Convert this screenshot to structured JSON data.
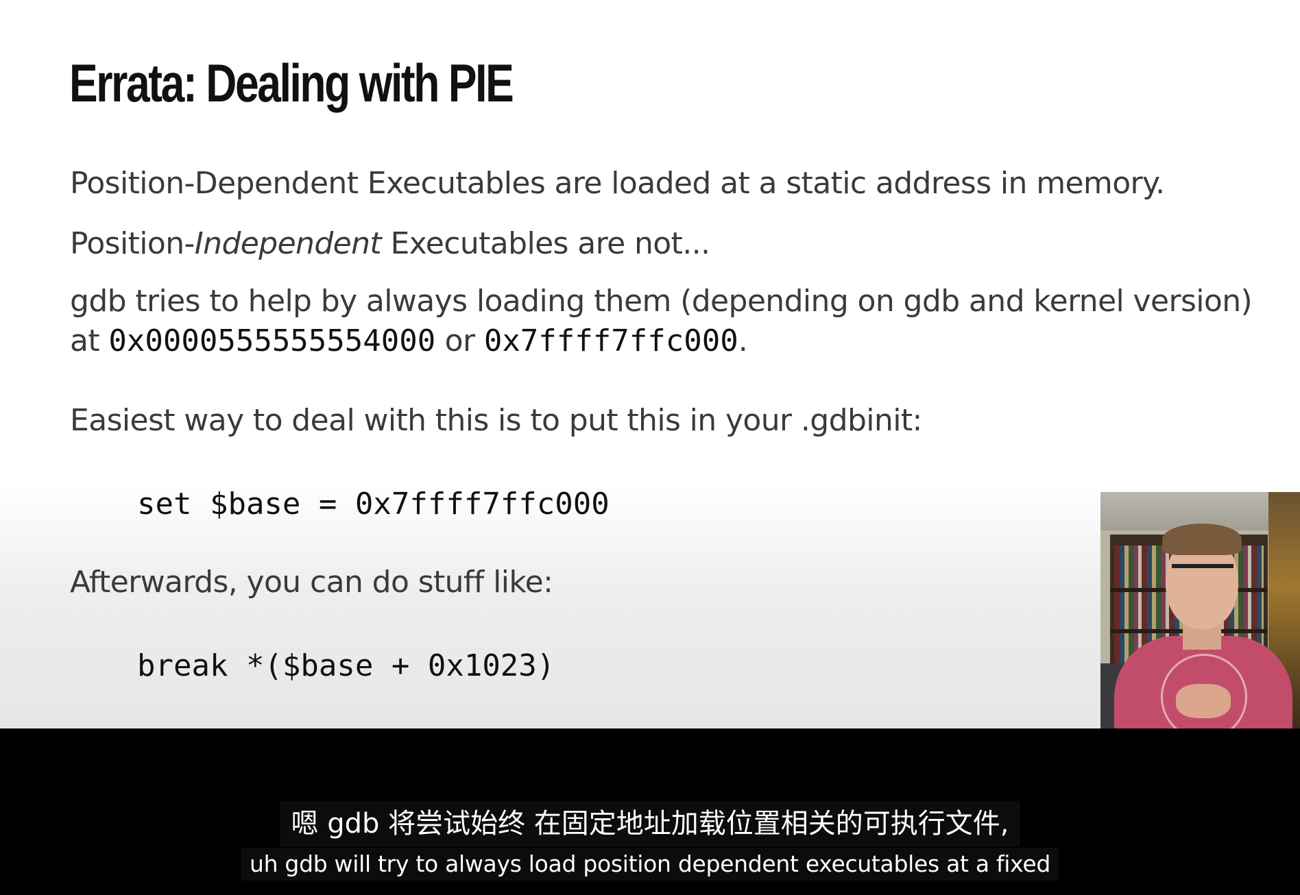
{
  "slide": {
    "title": "Errata: Dealing with PIE",
    "line_static": "Position-Dependent Executables are loaded at a static address in memory.",
    "line_independent": {
      "prefix": "Position-",
      "italic": "Independent",
      "suffix": " Executables are not..."
    },
    "line_gdb": "gdb tries to help by always loading them (depending on gdb and kernel version)",
    "line_at": {
      "prefix": "at ",
      "addr1": "0x0000555555554000",
      "middle": " or ",
      "addr2": "0x7ffff7ffc000",
      "suffix": "."
    },
    "line_easiest": "Easiest way to deal with this is to put this in your .gdbinit:",
    "code_set": "set $base = 0x7ffff7ffc000",
    "line_afterwards": "Afterwards, you can do stuff like:",
    "code_break": "break *($base + 0x1023)"
  },
  "subtitles": {
    "zh": "嗯 gdb 将尝试始终 在固定地址加载位置相关的可执行文件,",
    "en": "uh gdb will try to always load position dependent executables at a fixed"
  }
}
